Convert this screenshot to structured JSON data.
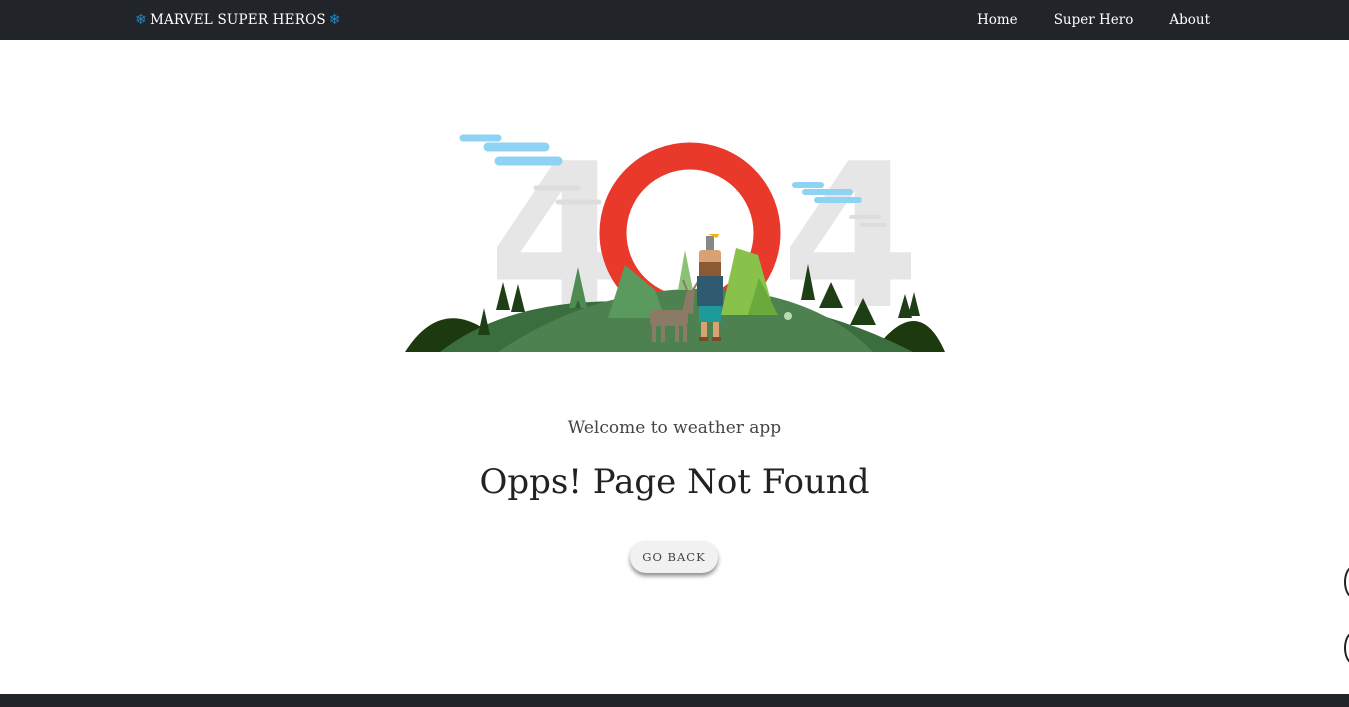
{
  "navbar": {
    "brand": "MARVEL SUPER HEROS",
    "brand_icon": "snowflake-icon",
    "brand_icon_color": "#1e88c8",
    "links": [
      {
        "label": "Home"
      },
      {
        "label": "Super Hero"
      },
      {
        "label": "About"
      }
    ]
  },
  "illustration": {
    "digits": [
      "4",
      "4"
    ],
    "ring_color": "#e8392b"
  },
  "content": {
    "welcome": "Welcome to weather app",
    "title": "Opps! Page Not Found",
    "button_label": "GO BACK"
  },
  "colors": {
    "navbar_bg": "#212529",
    "page_bg": "#ffffff"
  }
}
